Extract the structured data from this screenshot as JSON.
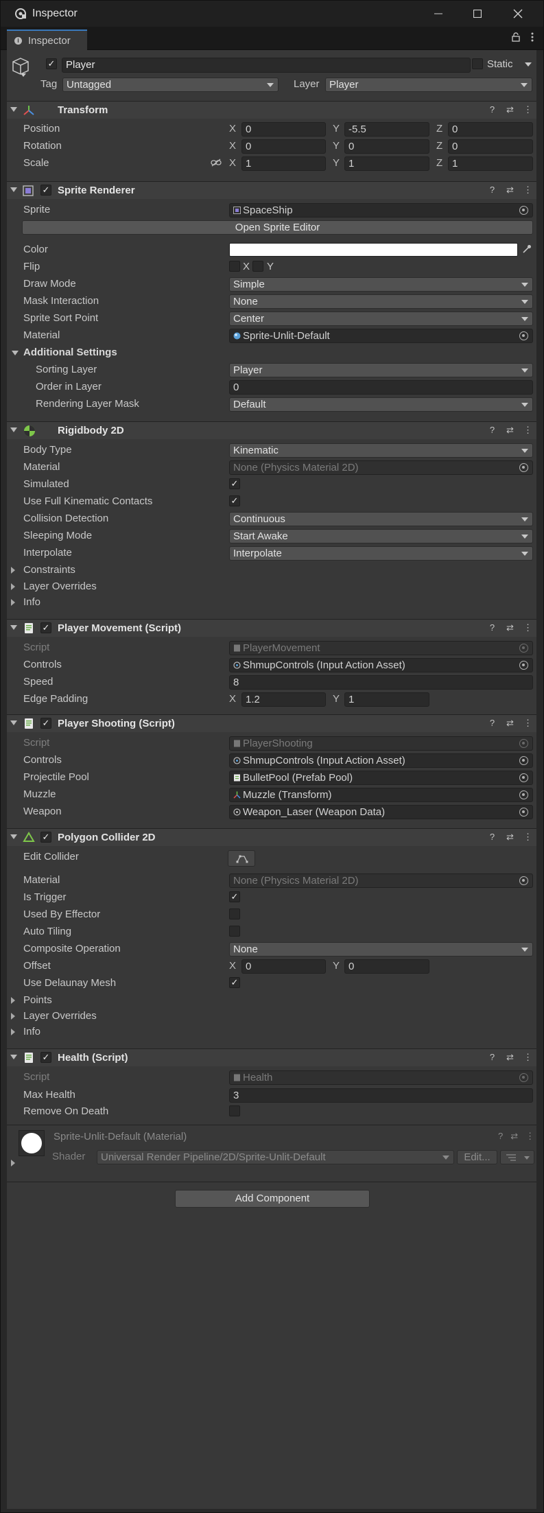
{
  "window": {
    "title": "Inspector",
    "tab_label": "Inspector"
  },
  "header": {
    "name": "Player",
    "static_label": "Static",
    "tag_label": "Tag",
    "tag_value": "Untagged",
    "layer_label": "Layer",
    "layer_value": "Player"
  },
  "transform": {
    "title": "Transform",
    "position": {
      "label": "Position",
      "x": "0",
      "y": "-5.5",
      "z": "0"
    },
    "rotation": {
      "label": "Rotation",
      "x": "0",
      "y": "0",
      "z": "0"
    },
    "scale": {
      "label": "Scale",
      "x": "1",
      "y": "1",
      "z": "1"
    },
    "axis": {
      "x": "X",
      "y": "Y",
      "z": "Z"
    }
  },
  "sprite_renderer": {
    "title": "Sprite Renderer",
    "sprite_label": "Sprite",
    "sprite_value": "SpaceShip",
    "open_editor": "Open Sprite Editor",
    "color_label": "Color",
    "color_value": "#ffffff",
    "flip_label": "Flip",
    "flip_x": "X",
    "flip_y": "Y",
    "draw_mode_label": "Draw Mode",
    "draw_mode_value": "Simple",
    "mask_label": "Mask Interaction",
    "mask_value": "None",
    "sort_point_label": "Sprite Sort Point",
    "sort_point_value": "Center",
    "material_label": "Material",
    "material_value": "Sprite-Unlit-Default",
    "additional": "Additional Settings",
    "sorting_layer_label": "Sorting Layer",
    "sorting_layer_value": "Player",
    "order_label": "Order in Layer",
    "order_value": "0",
    "rendering_mask_label": "Rendering Layer Mask",
    "rendering_mask_value": "Default"
  },
  "rigidbody": {
    "title": "Rigidbody 2D",
    "body_type_label": "Body Type",
    "body_type_value": "Kinematic",
    "material_label": "Material",
    "material_value": "None (Physics Material 2D)",
    "simulated_label": "Simulated",
    "full_kinematic_label": "Use Full Kinematic Contacts",
    "collision_label": "Collision Detection",
    "collision_value": "Continuous",
    "sleeping_label": "Sleeping Mode",
    "sleeping_value": "Start Awake",
    "interpolate_label": "Interpolate",
    "interpolate_value": "Interpolate",
    "constraints": "Constraints",
    "layer_overrides": "Layer Overrides",
    "info": "Info"
  },
  "player_movement": {
    "title": "Player Movement (Script)",
    "script_label": "Script",
    "script_value": "PlayerMovement",
    "controls_label": "Controls",
    "controls_value": "ShmupControls (Input Action Asset)",
    "speed_label": "Speed",
    "speed_value": "8",
    "edge_label": "Edge Padding",
    "edge_x": "1.2",
    "edge_y": "1"
  },
  "player_shooting": {
    "title": "Player Shooting (Script)",
    "script_label": "Script",
    "script_value": "PlayerShooting",
    "controls_label": "Controls",
    "controls_value": "ShmupControls (Input Action Asset)",
    "pool_label": "Projectile Pool",
    "pool_value": "BulletPool (Prefab Pool)",
    "muzzle_label": "Muzzle",
    "muzzle_value": "Muzzle (Transform)",
    "weapon_label": "Weapon",
    "weapon_value": "Weapon_Laser (Weapon Data)"
  },
  "polygon_collider": {
    "title": "Polygon Collider 2D",
    "edit_label": "Edit Collider",
    "material_label": "Material",
    "material_value": "None (Physics Material 2D)",
    "trigger_label": "Is Trigger",
    "effector_label": "Used By Effector",
    "tiling_label": "Auto Tiling",
    "composite_label": "Composite Operation",
    "composite_value": "None",
    "offset_label": "Offset",
    "offset_x": "0",
    "offset_y": "0",
    "delaunay_label": "Use Delaunay Mesh",
    "points": "Points",
    "layer_overrides": "Layer Overrides",
    "info": "Info"
  },
  "health": {
    "title": "Health (Script)",
    "script_label": "Script",
    "script_value": "Health",
    "max_label": "Max Health",
    "max_value": "3",
    "remove_label": "Remove On Death"
  },
  "material": {
    "title": "Sprite-Unlit-Default (Material)",
    "shader_label": "Shader",
    "shader_value": "Universal Render Pipeline/2D/Sprite-Unlit-Default",
    "edit_label": "Edit..."
  },
  "add_component": "Add Component",
  "colors": {
    "accent": "#3a79bb",
    "panel": "#383838",
    "header": "#3e3e3e"
  }
}
